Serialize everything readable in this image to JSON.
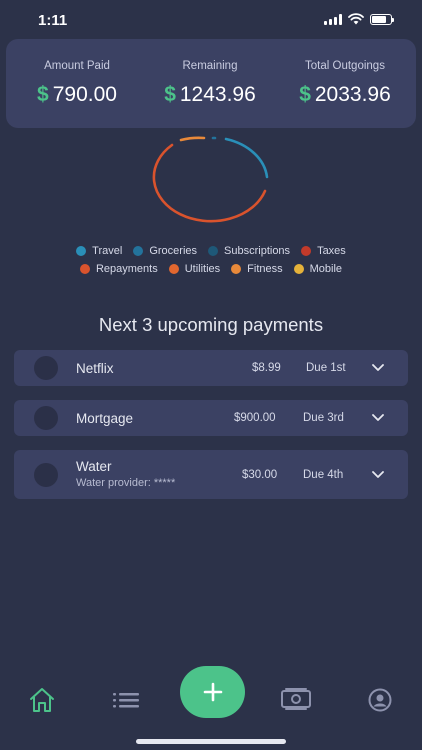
{
  "status_bar": {
    "time": "1:11"
  },
  "summary": {
    "currency_symbol": "$",
    "amount_paid_label": "Amount Paid",
    "amount_paid_value": "790.00",
    "remaining_label": "Remaining",
    "remaining_value": "1243.96",
    "total_label": "Total Outgoings",
    "total_value": "2033.96"
  },
  "legend": [
    {
      "label": "Travel",
      "color": "#2a8fb8"
    },
    {
      "label": "Groceries",
      "color": "#23739c"
    },
    {
      "label": "Subscriptions",
      "color": "#1e5878"
    },
    {
      "label": "Taxes",
      "color": "#c23a2a"
    },
    {
      "label": "Repayments",
      "color": "#d9532d"
    },
    {
      "label": "Utilities",
      "color": "#e2672f"
    },
    {
      "label": "Fitness",
      "color": "#e8893a"
    },
    {
      "label": "Mobile",
      "color": "#e5b23a"
    }
  ],
  "section_title": "Next 3 upcoming payments",
  "payments": [
    {
      "name": "Netflix",
      "amount": "$8.99",
      "due": "Due 1st"
    },
    {
      "name": "Mortgage",
      "amount": "$900.00",
      "due": "Due 3rd"
    },
    {
      "name": "Water",
      "subtitle": "Water provider: *****",
      "amount": "$30.00",
      "due": "Due 4th"
    }
  ],
  "colors": {
    "background": "#2c3249",
    "card": "#3b4163",
    "accent": "#4cc38a",
    "arc_blue": "#2a8fb8",
    "arc_red": "#d9532d"
  },
  "icons": {
    "home": "home-icon",
    "list": "list-icon",
    "add": "plus-icon",
    "money": "money-icon",
    "profile": "profile-icon"
  }
}
